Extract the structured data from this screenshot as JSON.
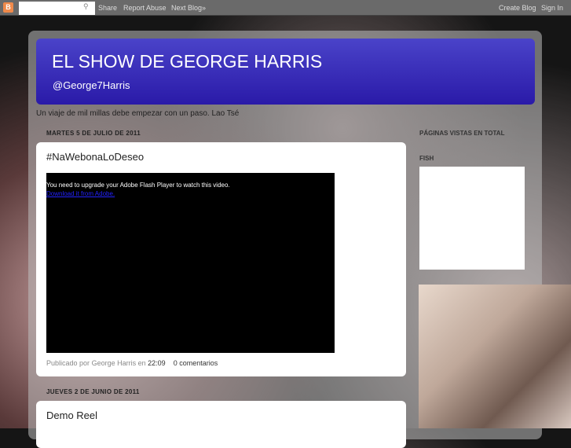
{
  "navbar": {
    "search_placeholder": "",
    "share": "Share",
    "report": "Report Abuse",
    "next": "Next Blog»",
    "create": "Create Blog",
    "signin": "Sign In"
  },
  "header": {
    "title": "EL SHOW DE GEORGE HARRIS",
    "subtitle": "@George7Harris"
  },
  "description": "Un viaje de mil millas debe empezar con un paso. Lao Tsé",
  "posts": [
    {
      "date": "MARTES 5 DE JULIO DE 2011",
      "title": "#NaWebonaLoDeseo",
      "flash_msg": "You need to upgrade your Adobe Flash Player to watch this video.",
      "flash_link": "Download it from Adobe.",
      "posted_by": "Publicado por",
      "author": "George Harris",
      "at": "en",
      "time": "22:09",
      "comments": "0 comentarios"
    },
    {
      "date": "JUEVES 2 DE JUNIO DE 2011",
      "title": "Demo Reel"
    }
  ],
  "sidebar": {
    "pageviews": "PÁGINAS VISTAS EN TOTAL",
    "fish": "FISH"
  }
}
